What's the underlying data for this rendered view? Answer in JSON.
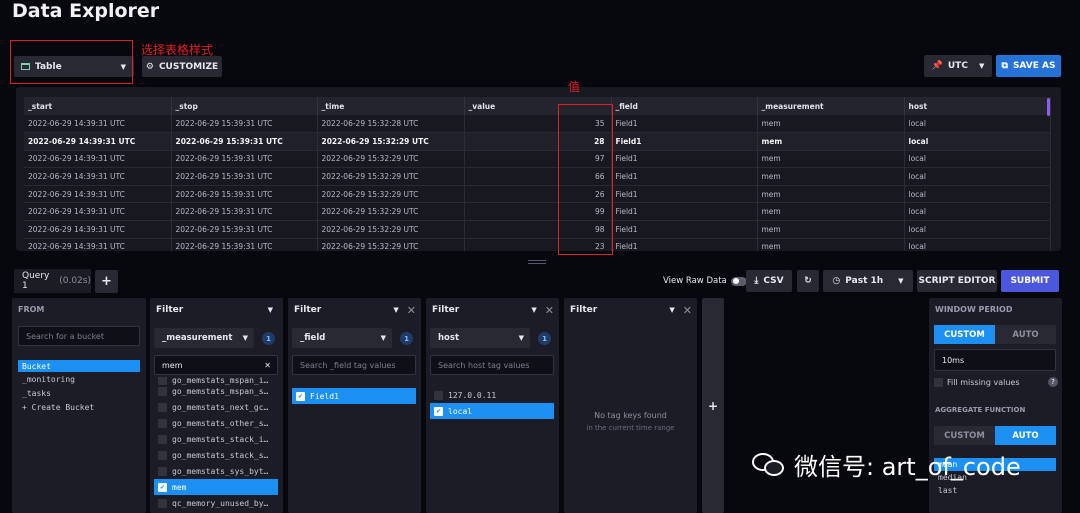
{
  "header": {
    "title": "Data Explorer"
  },
  "toolbar": {
    "viz_type": "Table",
    "customize": "CUSTOMIZE",
    "timezone": "UTC",
    "save_as": "SAVE AS"
  },
  "annotations": {
    "select_table": "选择表格样式",
    "value_label": "值"
  },
  "results": {
    "columns": [
      "_start",
      "_stop",
      "_time",
      "_value",
      "_field",
      "_measurement",
      "host"
    ],
    "rows": [
      [
        "2022-06-29 14:39:31 UTC",
        "2022-06-29 15:39:31 UTC",
        "2022-06-29 15:32:28 UTC",
        "35",
        "Field1",
        "mem",
        "local"
      ],
      [
        "2022-06-29 14:39:31 UTC",
        "2022-06-29 15:39:31 UTC",
        "2022-06-29 15:32:29 UTC",
        "28",
        "Field1",
        "mem",
        "local"
      ],
      [
        "2022-06-29 14:39:31 UTC",
        "2022-06-29 15:39:31 UTC",
        "2022-06-29 15:32:29 UTC",
        "97",
        "Field1",
        "mem",
        "local"
      ],
      [
        "2022-06-29 14:39:31 UTC",
        "2022-06-29 15:39:31 UTC",
        "2022-06-29 15:32:29 UTC",
        "66",
        "Field1",
        "mem",
        "local"
      ],
      [
        "2022-06-29 14:39:31 UTC",
        "2022-06-29 15:39:31 UTC",
        "2022-06-29 15:32:29 UTC",
        "26",
        "Field1",
        "mem",
        "local"
      ],
      [
        "2022-06-29 14:39:31 UTC",
        "2022-06-29 15:39:31 UTC",
        "2022-06-29 15:32:29 UTC",
        "99",
        "Field1",
        "mem",
        "local"
      ],
      [
        "2022-06-29 14:39:31 UTC",
        "2022-06-29 15:39:31 UTC",
        "2022-06-29 15:32:29 UTC",
        "98",
        "Field1",
        "mem",
        "local"
      ],
      [
        "2022-06-29 14:39:31 UTC",
        "2022-06-29 15:39:31 UTC",
        "2022-06-29 15:32:29 UTC",
        "23",
        "Field1",
        "mem",
        "local"
      ]
    ]
  },
  "query": {
    "tab_name": "Query 1",
    "tab_time": "(0.02s)",
    "add_tab": "+",
    "view_raw": "View Raw Data",
    "csv": "CSV",
    "time_range": "Past 1h",
    "script_editor": "SCRIPT EDITOR",
    "submit": "SUBMIT"
  },
  "from": {
    "title": "FROM",
    "search_placeholder": "Search for a bucket",
    "buckets": [
      "Bucket",
      "_monitoring",
      "_tasks",
      "+ Create Bucket"
    ]
  },
  "filter1": {
    "title": "Filter",
    "key": "_measurement",
    "count": "1",
    "search_value": "mem",
    "items": [
      "go_memstats_mspan_i…",
      "go_memstats_mspan_s…",
      "go_memstats_next_gc…",
      "go_memstats_other_s…",
      "go_memstats_stack_i…",
      "go_memstats_stack_s…",
      "go_memstats_sys_byt…",
      "mem",
      "qc_memory_unused_by…"
    ]
  },
  "filter2": {
    "title": "Filter",
    "key": "_field",
    "count": "1",
    "search_placeholder": "Search _field tag values",
    "items": [
      "Field1"
    ]
  },
  "filter3": {
    "title": "Filter",
    "key": "host",
    "count": "1",
    "search_placeholder": "Search host tag values",
    "items": [
      "127.0.0.11",
      "local"
    ]
  },
  "filter4": {
    "title": "Filter",
    "empty_title": "No tag keys found",
    "empty_sub": "in the current time range"
  },
  "add_filter": "+",
  "window": {
    "title": "WINDOW PERIOD",
    "custom": "CUSTOM",
    "auto": "AUTO",
    "period": "10ms",
    "fill_missing": "Fill missing values",
    "agg_title": "AGGREGATE FUNCTION",
    "functions": [
      "mean",
      "median",
      "last"
    ]
  },
  "watermark": {
    "text": "微信号: art_of_code"
  }
}
